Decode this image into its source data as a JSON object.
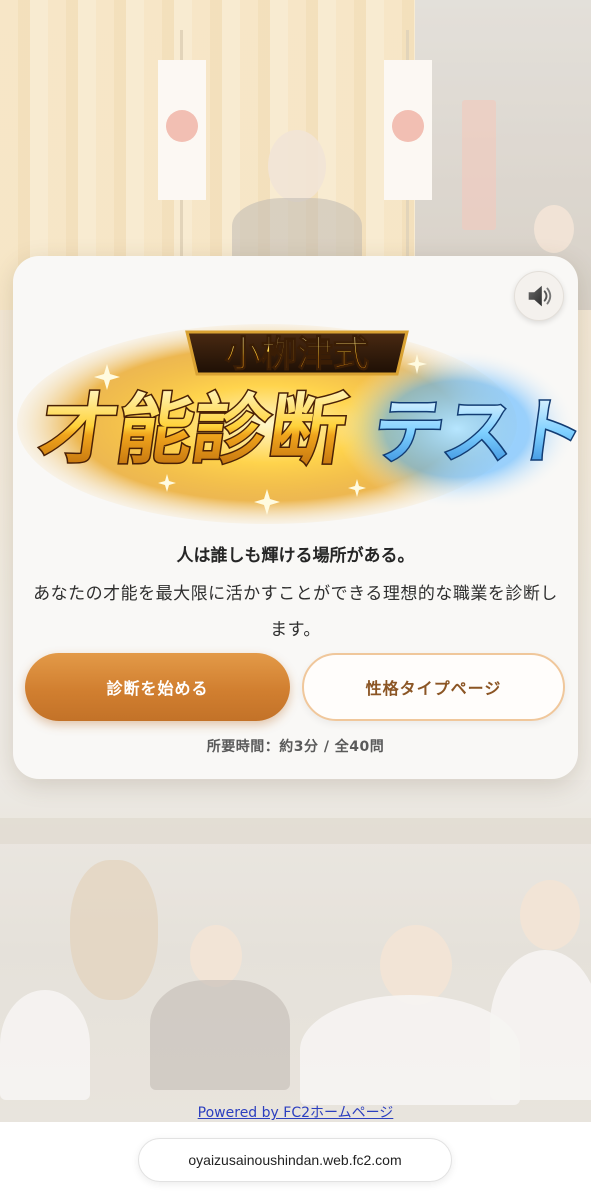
{
  "logo": {
    "top_text": "小栁津式",
    "main_text_gold": "才能診断",
    "main_text_blue": "テスト"
  },
  "intro": {
    "tagline": "人は誰しも輝ける場所がある。",
    "description": "あなたの才能を最大限に活かすことができる理想的な職業を診断します。"
  },
  "buttons": {
    "start_label": "診断を始める",
    "types_label": "性格タイプページ"
  },
  "meta": {
    "duration_text": "所要時間：約3分 / 全40問"
  },
  "sound": {
    "icon": "speaker-icon"
  },
  "footer": {
    "powered_by": "Powered by FC2ホームページ"
  },
  "browser": {
    "url": "oyaizusainoushindan.web.fc2.com"
  },
  "colors": {
    "start_button": "#d17f30",
    "types_border": "#f0c79b",
    "link": "#2c3fbf"
  }
}
